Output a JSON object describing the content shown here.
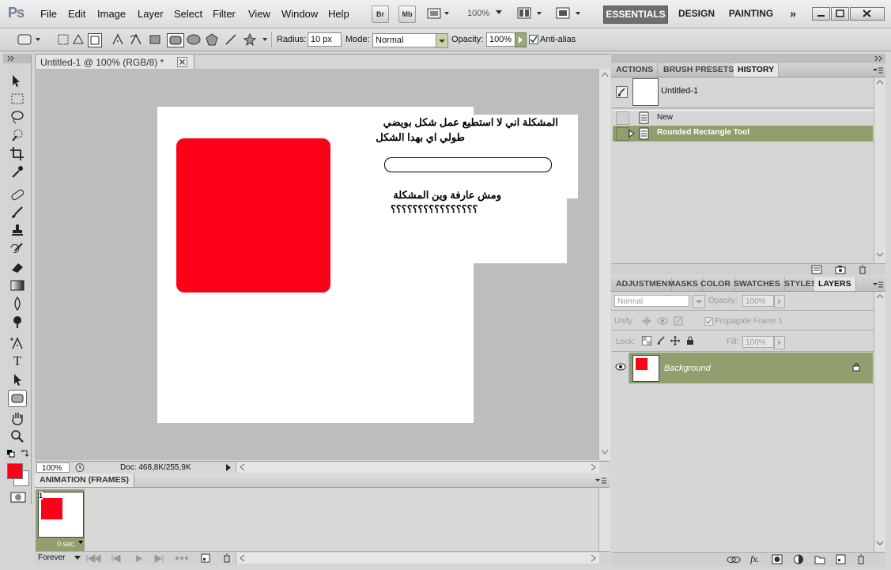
{
  "app": {
    "logo": "Ps",
    "menu": [
      "File",
      "Edit",
      "Image",
      "Layer",
      "Select",
      "Filter",
      "View",
      "Window",
      "Help"
    ],
    "bridge_label": "Br",
    "minibridge_label": "Mb",
    "zoom_level": "100%",
    "workspaces": [
      "ESSENTIALS",
      "DESIGN",
      "PAINTING"
    ],
    "more_workspaces": "»"
  },
  "options": {
    "radius_label": "Radius:",
    "radius_value": "10 px",
    "mode_label": "Mode:",
    "mode_value": "Normal",
    "opacity_label": "Opacity:",
    "opacity_value": "100%",
    "antialias_label": "Anti-alias",
    "antialias_checked": true
  },
  "document": {
    "tab_title": "Untitled-1 @ 100% (RGB/8) *",
    "annotation_line1": "المشكلة اني لا استطيع عمل شكل بويضي",
    "annotation_line2": "طولي اي بهدا الشكل",
    "annotation_line3": "ومش عارفة وين المشكلة",
    "annotation_line4": "؟؟؟؟؟؟؟؟؟؟؟؟؟؟؟؟",
    "shape_color": "#ff0019"
  },
  "status": {
    "zoom": "100%",
    "doc_info": "Doc: 468,8K/255,9K"
  },
  "animation": {
    "title": "ANIMATION (FRAMES)",
    "frame_number": "1",
    "frame_delay": "0 sec.",
    "loop": "Forever"
  },
  "history": {
    "tabs": [
      "ACTIONS",
      "BRUSH PRESETS",
      "HISTORY"
    ],
    "active_tab": "HISTORY",
    "snapshot": "Untitled-1",
    "steps": [
      "New",
      "Rounded Rectangle Tool"
    ]
  },
  "layers_panel": {
    "tabs": [
      "ADJUSTMEN",
      "MASKS",
      "COLOR",
      "SWATCHES",
      "STYLES",
      "LAYERS"
    ],
    "active_tab": "LAYERS",
    "blend_mode": "Normal",
    "opacity_label": "Opacity:",
    "opacity_value": "100%",
    "unify_label": "Unify:",
    "propagate_label": "Propagate Frame 1",
    "lock_label": "Lock:",
    "fill_label": "Fill:",
    "fill_value": "100%",
    "layer_name": "Background"
  },
  "colors": {
    "foreground": "#ff0019",
    "background": "#ffffff",
    "selection_green": "#919e6d"
  }
}
